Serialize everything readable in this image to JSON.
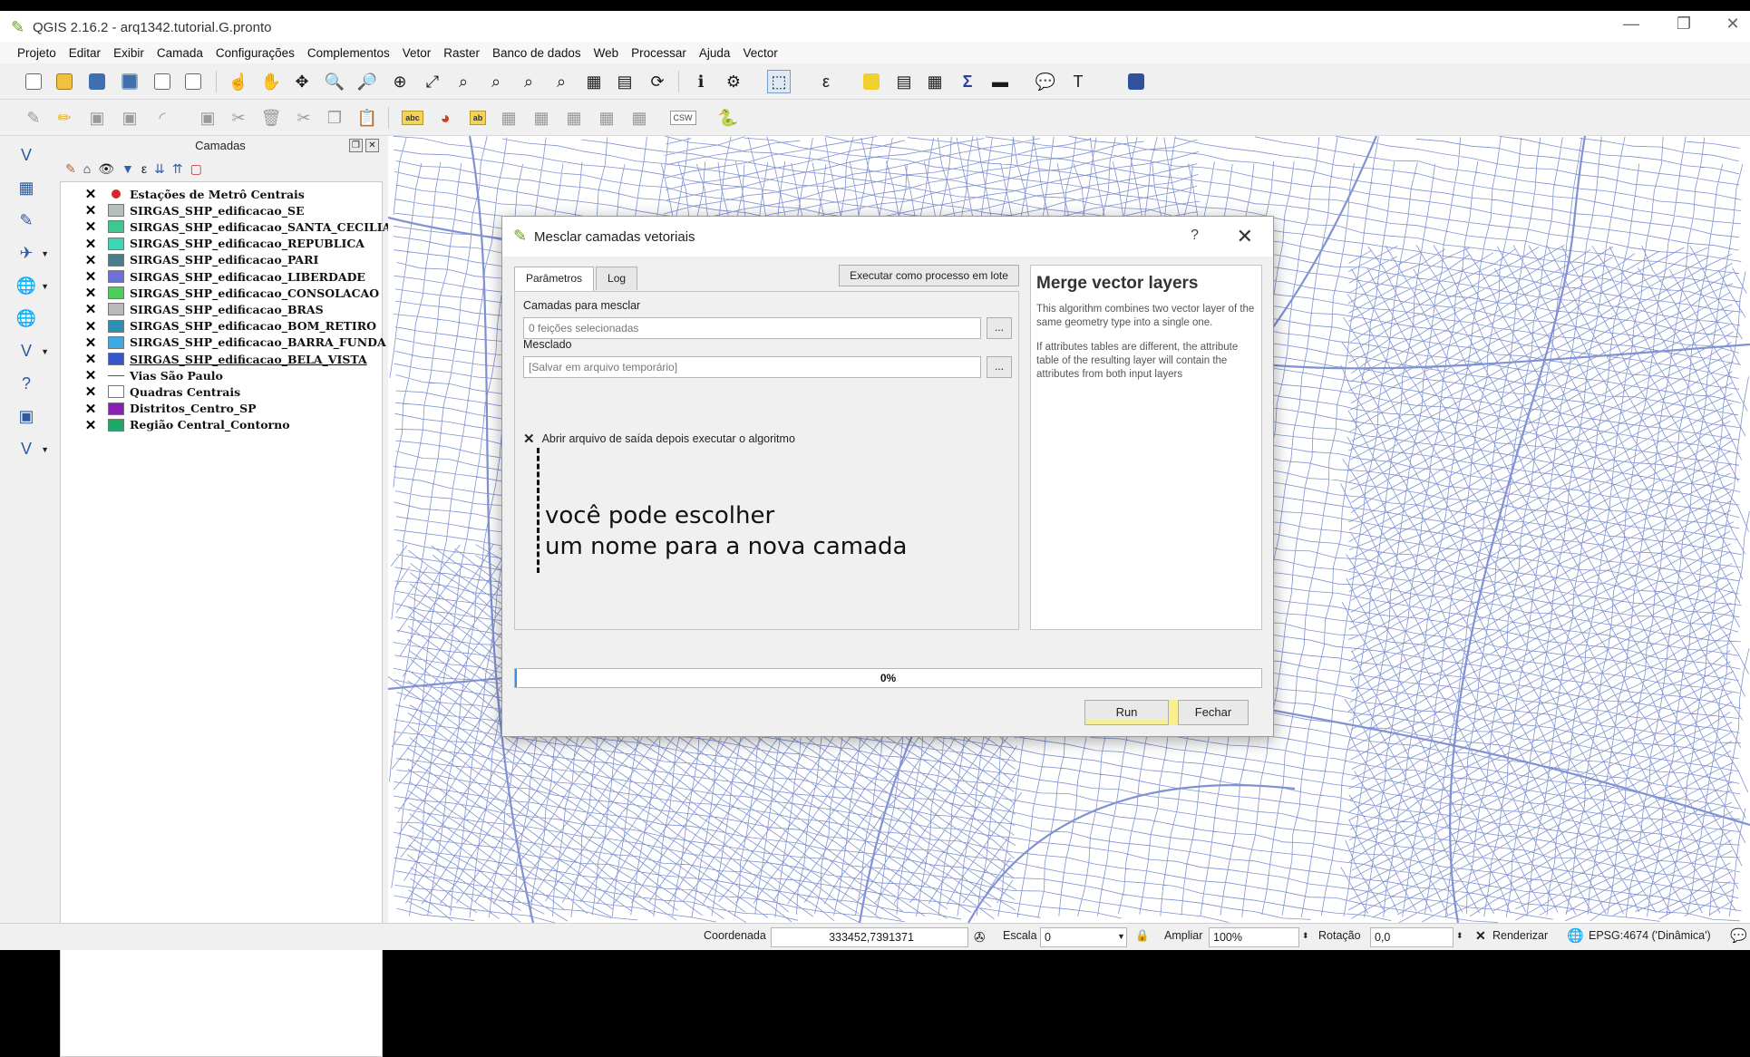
{
  "window": {
    "title": "QGIS 2.16.2 - arq1342.tutorial.G.pronto",
    "minimize": "—",
    "restore": "❐",
    "close": "✕"
  },
  "menu": [
    "Projeto",
    "Editar",
    "Exibir",
    "Camada",
    "Configurações",
    "Complementos",
    "Vetor",
    "Raster",
    "Banco de dados",
    "Web",
    "Processar",
    "Ajuda",
    "Vector"
  ],
  "layers_panel": {
    "title": "Camadas",
    "layers": [
      {
        "name": "Estações de Metrô Centrais",
        "color": "#d62728",
        "symbol": "point",
        "checked": "✕"
      },
      {
        "name": "SIRGAS_SHP_edificacao_SE",
        "color": "#b8bdbf",
        "symbol": "fill",
        "checked": "✕"
      },
      {
        "name": "SIRGAS_SHP_edificacao_SANTA_CECILIA",
        "color": "#3cc98f",
        "symbol": "fill",
        "checked": "✕"
      },
      {
        "name": "SIRGAS_SHP_edificacao_REPUBLICA",
        "color": "#3fd6b4",
        "symbol": "fill",
        "checked": "✕"
      },
      {
        "name": "SIRGAS_SHP_edificacao_PARI",
        "color": "#4a7f8a",
        "symbol": "fill",
        "checked": "✕"
      },
      {
        "name": "SIRGAS_SHP_edificacao_LIBERDADE",
        "color": "#6f6fd8",
        "symbol": "fill",
        "checked": "✕"
      },
      {
        "name": "SIRGAS_SHP_edificacao_CONSOLACAO",
        "color": "#4ccf5a",
        "symbol": "fill",
        "checked": "✕"
      },
      {
        "name": "SIRGAS_SHP_edificacao_BRAS",
        "color": "#b9b9b9",
        "symbol": "fill",
        "checked": "✕"
      },
      {
        "name": "SIRGAS_SHP_edificacao_BOM_RETIRO",
        "color": "#2f8fb0",
        "symbol": "fill",
        "checked": "✕"
      },
      {
        "name": "SIRGAS_SHP_edificacao_BARRA_FUNDA",
        "color": "#3fa8e0",
        "symbol": "fill",
        "checked": "✕"
      },
      {
        "name": "SIRGAS_SHP_edificacao_BELA_VISTA",
        "color": "#3555c8",
        "symbol": "fill",
        "checked": "✕",
        "selected": true
      },
      {
        "name": "Vias São Paulo",
        "color": "#555555",
        "symbol": "line",
        "checked": "✕"
      },
      {
        "name": "Quadras Centrais",
        "color": "#ffffff",
        "symbol": "fill",
        "checked": "✕"
      },
      {
        "name": "Distritos_Centro_SP",
        "color": "#8a1fb0",
        "symbol": "fill",
        "checked": "✕"
      },
      {
        "name": "Região Central_Contorno",
        "color": "#1fa86a",
        "symbol": "fill",
        "checked": "✕"
      }
    ]
  },
  "dialog": {
    "title": "Mesclar camadas vetoriais",
    "help_icon": "?",
    "close_icon": "✕",
    "tabs": [
      "Parâmetros",
      "Log"
    ],
    "batch_button": "Executar como processo em lote",
    "input_label": "Camadas para mesclar",
    "input_value": "0 feições selecionadas",
    "output_label": "Mesclado",
    "output_value": "[Salvar em arquivo temporário]",
    "browse_label": "...",
    "open_output_label": "Abrir arquivo de saída depois executar o algoritmo",
    "open_output_checked": "✕",
    "annotation_line1": "você pode escolher",
    "annotation_line2": "um nome para a nova camada",
    "help_title": "Merge vector layers",
    "help_p1": "This algorithm combines two vector layer of the same geometry type into a single one.",
    "help_p2": "If attributes tables are different, the attribute table of the resulting layer will contain the attributes from both input layers",
    "progress_text": "0%",
    "progress_value": 0,
    "run_button": "Run",
    "close_button": "Fechar"
  },
  "statusbar": {
    "coord_label": "Coordenada",
    "coord_value": "333452,7391371",
    "scale_label": "Escala",
    "scale_value": "0",
    "magnifier_label": "Ampliar",
    "magnifier_value": "100%",
    "rotation_label": "Rotação",
    "rotation_value": "0,0",
    "render_label": "Renderizar",
    "render_checked": "✕",
    "crs_label": "EPSG:4674 ('Dinâmica')"
  },
  "colors": {
    "map_lines": "#6b7fc9",
    "accent": "#3c8ee0",
    "highlight": "#fff03c"
  }
}
